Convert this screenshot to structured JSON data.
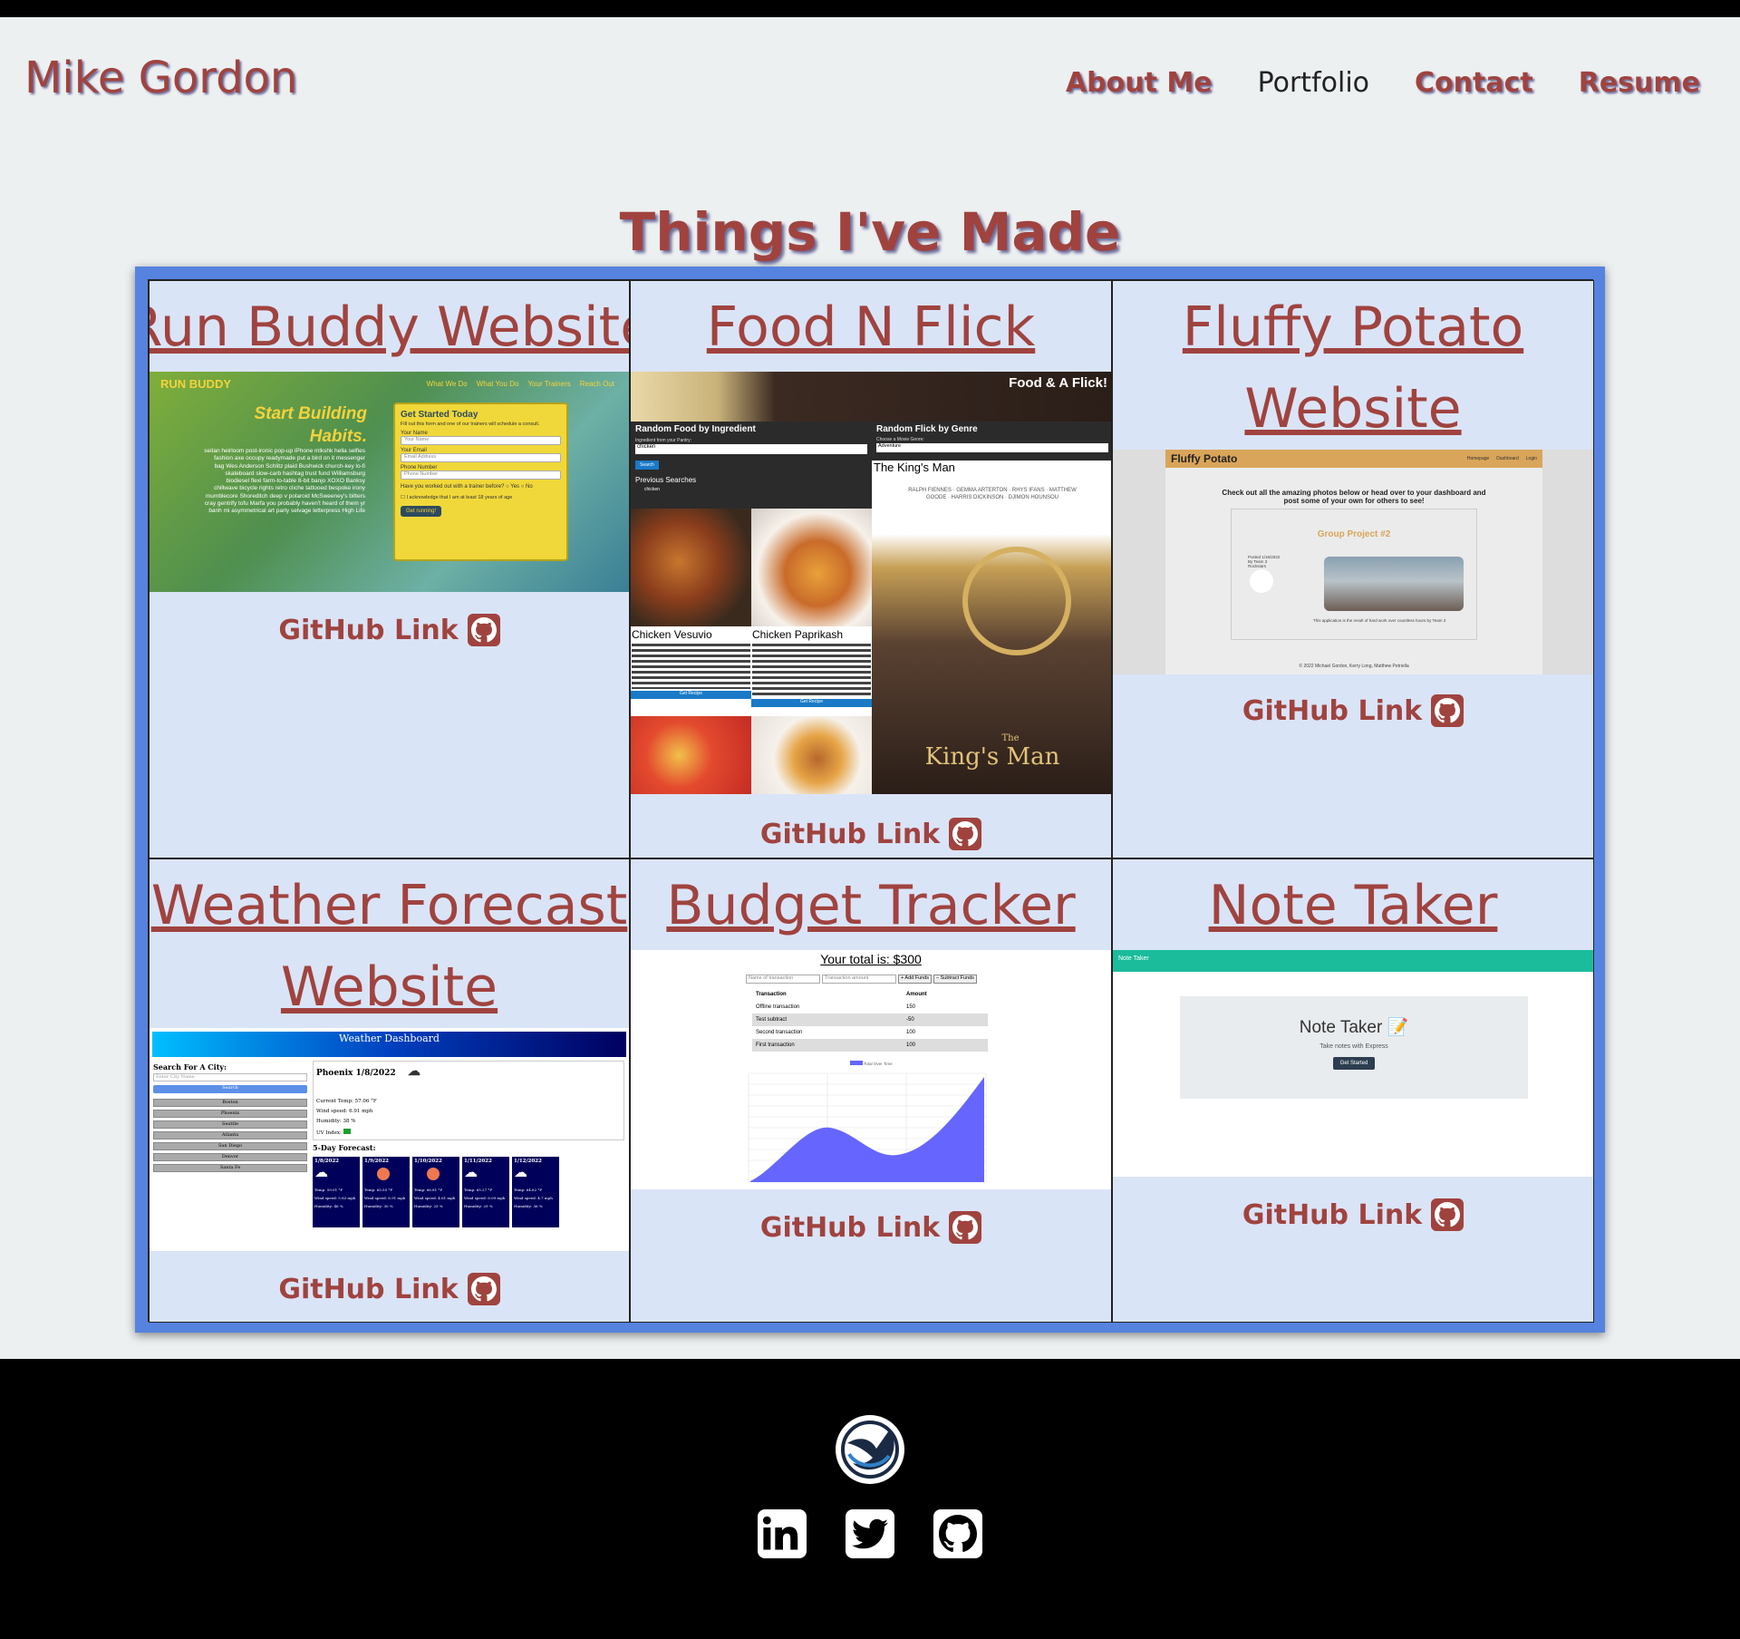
{
  "header": {
    "site_title": "Mike Gordon",
    "nav": [
      {
        "label": "About Me",
        "highlight": true
      },
      {
        "label": "Portfolio",
        "highlight": false
      },
      {
        "label": "Contact",
        "highlight": true
      },
      {
        "label": "Resume",
        "highlight": true
      }
    ]
  },
  "main": {
    "section_title": "Things I've Made",
    "github_label": "GitHub Link",
    "projects": [
      {
        "title_line1": "Run Buddy Website",
        "title_line2": ""
      },
      {
        "title_line1": "Food N Flick",
        "title_line2": ""
      },
      {
        "title_line1": "Fluffy Potato",
        "title_line2": "Website"
      },
      {
        "title_line1": "Weather Forecast",
        "title_line2": "Website"
      },
      {
        "title_line1": "Budget Tracker",
        "title_line2": ""
      },
      {
        "title_line1": "Note Taker",
        "title_line2": ""
      }
    ],
    "screens": {
      "runbuddy": {
        "brand": "RUN BUDDY",
        "nav": [
          "What We Do",
          "What You Do",
          "Your Trainers",
          "Reach Out"
        ],
        "headline1": "Start Building",
        "headline2": "Habits.",
        "blurb": "seitan heirloom post-ironic pop-up iPhone mlkshk hella selfies fashion axe occupy readymade put a bird on it messenger bag Wes Anderson Schlitz plaid Bushwick church-key lo-fi skateboard slow-carb hashtag trust fund Williamsburg biodiesel flexi farm-to-table 8-bit banjo XOXO Banksy chillwave bicycle rights retro cliche tattooed bespoke irony mumblecore Shoreditch deep v polaroid McSweeney's bitters cray gentrify tofu Marfa you probably haven't heard of them yr banh mi asymmetrical art party selvage letterpress High Life",
        "form_title": "Get Started Today",
        "form_sub": "Fill out this form and one of our trainers will schedule a consult.",
        "label_name": "Your Name",
        "ph_name": "Your Name",
        "label_email": "Your Email",
        "ph_email": "Email Address",
        "label_phone": "Phone Number",
        "ph_phone": "Phone Number",
        "question": "Have you worked out with a trainer before?",
        "yes": "Yes",
        "no": "No",
        "ack": "I acknowledge that I am at least 18 years of age",
        "button": "Get running!"
      },
      "foodflick": {
        "brand": "Food & A Flick!",
        "food_head": "Random Food by Ingredient",
        "food_label": "Ingredient from your Pantry:",
        "food_value": "chicken",
        "search_btn": "Search",
        "prev": "Previous Searches",
        "prev_item": "chicken",
        "recipe1": "Chicken Vesuvio",
        "recipe2": "Chicken Paprikash",
        "recipe_btn": "Get Recipe",
        "flick_head": "Random Flick by Genre",
        "flick_label": "Choose a Movie Genre:",
        "flick_value": "Adventure",
        "movie": "The King's Man",
        "poster_names": "RALPH FIENNES · GEMMA ARTERTON · RHYS IFANS · MATTHEW GOODE · HARRIS DICKINSON · DJIMON HOUNSOU",
        "poster_the": "The",
        "poster_title": "King's Man"
      },
      "fluffy": {
        "brand": "Fluffy Potato",
        "nav": [
          "Homepage",
          "Dashboard",
          "Login"
        ],
        "intro": "Check out all the amazing photos below or head over to your dashboard and post some of your own for others to see!",
        "card_title": "Group Project #2",
        "posted": "Posted 1/16/2022 By Team 3 Rockstars",
        "caption": "This application is the result of hard work over countless hours by Team 3",
        "footer": "© 2022 Michael Gordon, Kerry Long, Matthew Petriella"
      },
      "weather": {
        "banner": "Weather Dashboard",
        "search_label": "Search For A City:",
        "search_ph": "Enter City Name",
        "search_btn": "Search",
        "cities": [
          "Boston",
          "Phoenix",
          "Seattle",
          "Atlanta",
          "San Diego",
          "Denver",
          "Santa Fe"
        ],
        "current_city": "Phoenix",
        "current_date": "1/8/2022",
        "temp": "Current Temp: 57.06 °F",
        "wind": "Wind speed: 6.91 mph",
        "humidity": "Humidity: 38 %",
        "uv": "UV Index:",
        "forecast_label": "5-Day Forecast:",
        "days": [
          {
            "date": "1/8/2022",
            "temp": "Temp: 59.01 °F",
            "wind": "Wind speed: 5.83 mph",
            "hum": "Humidity: 46 %",
            "icon": "cloud"
          },
          {
            "date": "1/9/2022",
            "temp": "Temp: 65.55 °F",
            "wind": "Wind speed: 6.91 mph",
            "hum": "Humidity: 30 %",
            "icon": "sun"
          },
          {
            "date": "1/10/2022",
            "temp": "Temp: 66.81 °F",
            "wind": "Wind speed: 4.61 mph",
            "hum": "Humidity: 25 %",
            "icon": "sun"
          },
          {
            "date": "1/11/2022",
            "temp": "Temp: 65.27 °F",
            "wind": "Wind speed: 6.09 mph",
            "hum": "Humidity: 29 %",
            "icon": "cloud"
          },
          {
            "date": "1/12/2022",
            "temp": "Temp: 64.62 °F",
            "wind": "Wind speed: 4.7 mph",
            "hum": "Humidity: 36 %",
            "icon": "cloud"
          }
        ]
      },
      "budget": {
        "total": "Your total is: $300",
        "ph_name": "Name of transaction",
        "ph_amount": "Transaction amount",
        "add_btn": "+ Add Funds",
        "sub_btn": "– Subtract Funds",
        "col1": "Transaction",
        "col2": "Amount",
        "rows": [
          [
            "Offline transaction",
            "150"
          ],
          [
            "Test subtract",
            "-50"
          ],
          [
            "Second transaction",
            "100"
          ],
          [
            "First transaction",
            "100"
          ]
        ],
        "legend": "Total Over Time",
        "colors": {
          "fill": "#6666ff"
        }
      },
      "notetaker": {
        "bar": "Note Taker",
        "title": "Note Taker",
        "sub": "Take notes with Express",
        "button": "Get Started",
        "colors": {
          "bar": "#1abc9c"
        }
      }
    }
  },
  "colors": {
    "accent": "#a0433f",
    "frame": "#5583df",
    "card_bg": "#dae4f7",
    "page_bg": "#ecf0f1"
  },
  "footer": {
    "logo": "v-logo-icon",
    "social": [
      "linkedin-icon",
      "twitter-icon",
      "github-icon"
    ]
  }
}
